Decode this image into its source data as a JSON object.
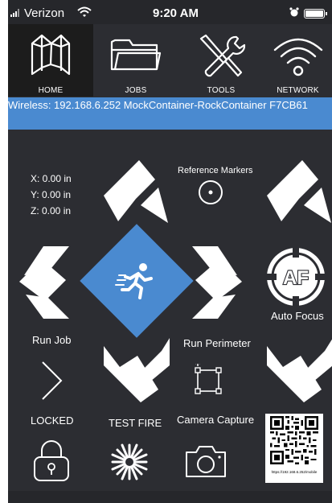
{
  "status_bar": {
    "carrier": "Verizon",
    "time": "9:20 AM"
  },
  "nav": {
    "items": [
      {
        "label": "HOME",
        "icon": "home-logo-icon",
        "active": true
      },
      {
        "label": "JOBS",
        "icon": "folder-icon",
        "active": false
      },
      {
        "label": "TOOLS",
        "icon": "tools-icon",
        "active": false
      },
      {
        "label": "NETWORK",
        "icon": "wifi-icon",
        "active": false
      }
    ]
  },
  "info_banner": "Wireless: 192.168.6.252 MockContainer-RockContainer F7CB61",
  "coords": {
    "x": "X: 0.00 in",
    "y": "Y: 0.00 in",
    "z": "Z: 0.00 in"
  },
  "labels": {
    "reference_markers": "Reference Markers",
    "auto_focus": "Auto Focus",
    "auto_focus_badge": "AF",
    "run_job": "Run Job",
    "run_perimeter": "Run Perimeter",
    "locked": "LOCKED",
    "test_fire": "TEST FIRE",
    "camera_capture": "Camera Capture",
    "qr_caption": "https://192.168.6.252/mobile"
  },
  "colors": {
    "background": "#2c2d32",
    "accent": "#4a8ad0",
    "active_nav": "#1c1c1c"
  }
}
